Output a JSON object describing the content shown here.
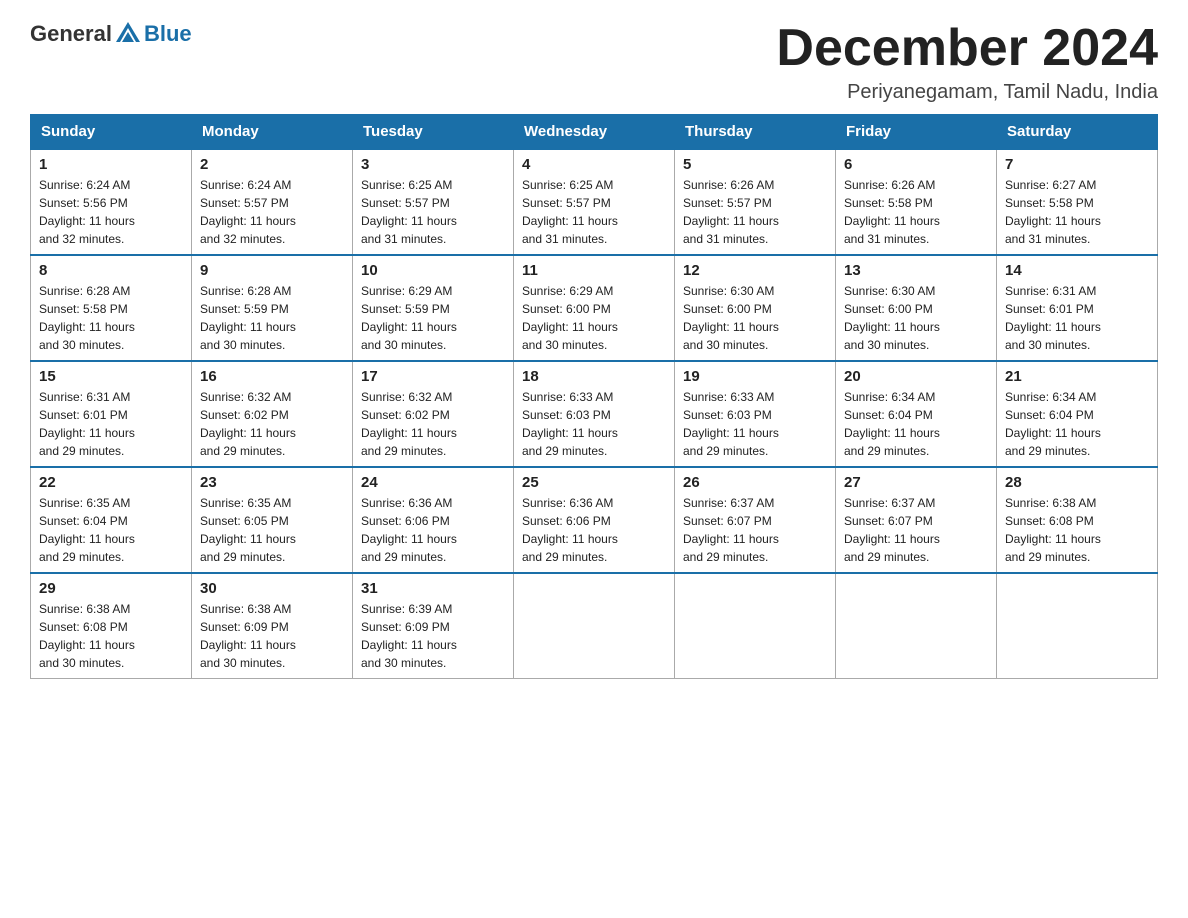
{
  "header": {
    "logo_text_general": "General",
    "logo_text_blue": "Blue",
    "month_title": "December 2024",
    "location": "Periyanegamam, Tamil Nadu, India"
  },
  "weekdays": [
    "Sunday",
    "Monday",
    "Tuesday",
    "Wednesday",
    "Thursday",
    "Friday",
    "Saturday"
  ],
  "weeks": [
    [
      {
        "day": "1",
        "sunrise": "6:24 AM",
        "sunset": "5:56 PM",
        "daylight": "11 hours and 32 minutes."
      },
      {
        "day": "2",
        "sunrise": "6:24 AM",
        "sunset": "5:57 PM",
        "daylight": "11 hours and 32 minutes."
      },
      {
        "day": "3",
        "sunrise": "6:25 AM",
        "sunset": "5:57 PM",
        "daylight": "11 hours and 31 minutes."
      },
      {
        "day": "4",
        "sunrise": "6:25 AM",
        "sunset": "5:57 PM",
        "daylight": "11 hours and 31 minutes."
      },
      {
        "day": "5",
        "sunrise": "6:26 AM",
        "sunset": "5:57 PM",
        "daylight": "11 hours and 31 minutes."
      },
      {
        "day": "6",
        "sunrise": "6:26 AM",
        "sunset": "5:58 PM",
        "daylight": "11 hours and 31 minutes."
      },
      {
        "day": "7",
        "sunrise": "6:27 AM",
        "sunset": "5:58 PM",
        "daylight": "11 hours and 31 minutes."
      }
    ],
    [
      {
        "day": "8",
        "sunrise": "6:28 AM",
        "sunset": "5:58 PM",
        "daylight": "11 hours and 30 minutes."
      },
      {
        "day": "9",
        "sunrise": "6:28 AM",
        "sunset": "5:59 PM",
        "daylight": "11 hours and 30 minutes."
      },
      {
        "day": "10",
        "sunrise": "6:29 AM",
        "sunset": "5:59 PM",
        "daylight": "11 hours and 30 minutes."
      },
      {
        "day": "11",
        "sunrise": "6:29 AM",
        "sunset": "6:00 PM",
        "daylight": "11 hours and 30 minutes."
      },
      {
        "day": "12",
        "sunrise": "6:30 AM",
        "sunset": "6:00 PM",
        "daylight": "11 hours and 30 minutes."
      },
      {
        "day": "13",
        "sunrise": "6:30 AM",
        "sunset": "6:00 PM",
        "daylight": "11 hours and 30 minutes."
      },
      {
        "day": "14",
        "sunrise": "6:31 AM",
        "sunset": "6:01 PM",
        "daylight": "11 hours and 30 minutes."
      }
    ],
    [
      {
        "day": "15",
        "sunrise": "6:31 AM",
        "sunset": "6:01 PM",
        "daylight": "11 hours and 29 minutes."
      },
      {
        "day": "16",
        "sunrise": "6:32 AM",
        "sunset": "6:02 PM",
        "daylight": "11 hours and 29 minutes."
      },
      {
        "day": "17",
        "sunrise": "6:32 AM",
        "sunset": "6:02 PM",
        "daylight": "11 hours and 29 minutes."
      },
      {
        "day": "18",
        "sunrise": "6:33 AM",
        "sunset": "6:03 PM",
        "daylight": "11 hours and 29 minutes."
      },
      {
        "day": "19",
        "sunrise": "6:33 AM",
        "sunset": "6:03 PM",
        "daylight": "11 hours and 29 minutes."
      },
      {
        "day": "20",
        "sunrise": "6:34 AM",
        "sunset": "6:04 PM",
        "daylight": "11 hours and 29 minutes."
      },
      {
        "day": "21",
        "sunrise": "6:34 AM",
        "sunset": "6:04 PM",
        "daylight": "11 hours and 29 minutes."
      }
    ],
    [
      {
        "day": "22",
        "sunrise": "6:35 AM",
        "sunset": "6:04 PM",
        "daylight": "11 hours and 29 minutes."
      },
      {
        "day": "23",
        "sunrise": "6:35 AM",
        "sunset": "6:05 PM",
        "daylight": "11 hours and 29 minutes."
      },
      {
        "day": "24",
        "sunrise": "6:36 AM",
        "sunset": "6:06 PM",
        "daylight": "11 hours and 29 minutes."
      },
      {
        "day": "25",
        "sunrise": "6:36 AM",
        "sunset": "6:06 PM",
        "daylight": "11 hours and 29 minutes."
      },
      {
        "day": "26",
        "sunrise": "6:37 AM",
        "sunset": "6:07 PM",
        "daylight": "11 hours and 29 minutes."
      },
      {
        "day": "27",
        "sunrise": "6:37 AM",
        "sunset": "6:07 PM",
        "daylight": "11 hours and 29 minutes."
      },
      {
        "day": "28",
        "sunrise": "6:38 AM",
        "sunset": "6:08 PM",
        "daylight": "11 hours and 29 minutes."
      }
    ],
    [
      {
        "day": "29",
        "sunrise": "6:38 AM",
        "sunset": "6:08 PM",
        "daylight": "11 hours and 30 minutes."
      },
      {
        "day": "30",
        "sunrise": "6:38 AM",
        "sunset": "6:09 PM",
        "daylight": "11 hours and 30 minutes."
      },
      {
        "day": "31",
        "sunrise": "6:39 AM",
        "sunset": "6:09 PM",
        "daylight": "11 hours and 30 minutes."
      },
      null,
      null,
      null,
      null
    ]
  ],
  "labels": {
    "sunrise": "Sunrise:",
    "sunset": "Sunset:",
    "daylight": "Daylight:"
  }
}
